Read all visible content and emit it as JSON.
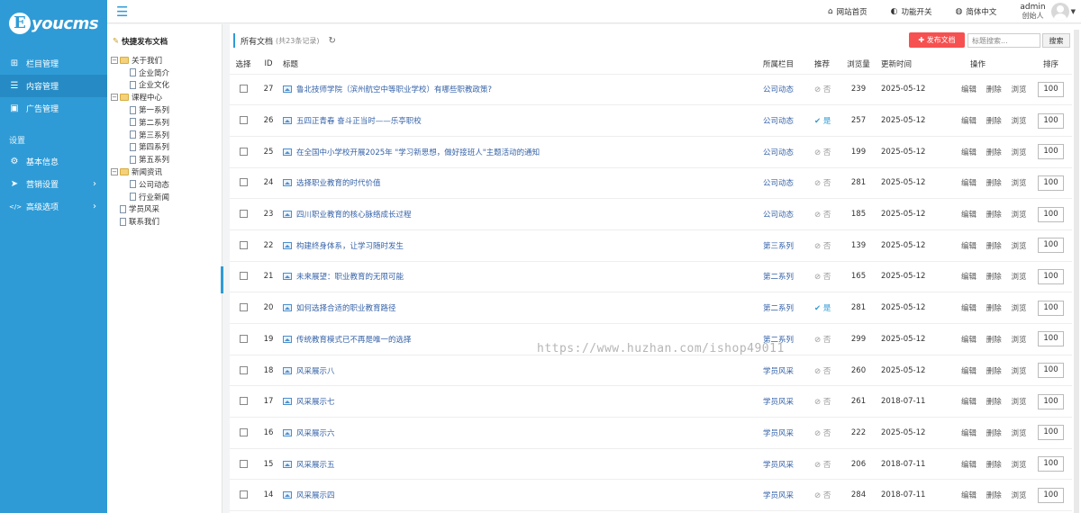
{
  "brand": {
    "badge": "E",
    "text": "youcms"
  },
  "sidebar": {
    "items": [
      {
        "label": "栏目管理",
        "icon": "sitemap-icon",
        "glyph": "⊞",
        "active": false
      },
      {
        "label": "内容管理",
        "icon": "list-icon",
        "glyph": "☰",
        "active": true
      },
      {
        "label": "广告管理",
        "icon": "image-icon",
        "glyph": "▣",
        "active": false
      }
    ],
    "settings_heading": "设置",
    "settings": [
      {
        "label": "基本信息",
        "icon": "gear-icon",
        "glyph": "⚙",
        "arrow": false
      },
      {
        "label": "营销设置",
        "icon": "send-icon",
        "glyph": "➤",
        "arrow": true
      },
      {
        "label": "高级选项",
        "icon": "code-icon",
        "glyph": "</>",
        "arrow": true
      }
    ]
  },
  "topbar": {
    "links": [
      {
        "label": "网站首页",
        "icon": "home-icon",
        "glyph": "⌂"
      },
      {
        "label": "功能开关",
        "icon": "toggle-icon",
        "glyph": "◐"
      },
      {
        "label": "简体中文",
        "icon": "globe-icon",
        "glyph": "◍"
      }
    ],
    "user_name": "admin",
    "user_role": "创始人"
  },
  "tree": {
    "heading": "快捷发布文档",
    "nodes": [
      {
        "label": "关于我们",
        "type": "folder"
      },
      {
        "label": "企业简介",
        "type": "child"
      },
      {
        "label": "企业文化",
        "type": "child"
      },
      {
        "label": "课程中心",
        "type": "folder"
      },
      {
        "label": "第一系列",
        "type": "child"
      },
      {
        "label": "第二系列",
        "type": "child"
      },
      {
        "label": "第三系列",
        "type": "child"
      },
      {
        "label": "第四系列",
        "type": "child"
      },
      {
        "label": "第五系列",
        "type": "child"
      },
      {
        "label": "新闻资讯",
        "type": "folder"
      },
      {
        "label": "公司动态",
        "type": "child"
      },
      {
        "label": "行业新闻",
        "type": "child"
      },
      {
        "label": "学员风采",
        "type": "leaf"
      },
      {
        "label": "联系我们",
        "type": "leaf"
      }
    ]
  },
  "main": {
    "title": "所有文档",
    "count": "(共23条记录)",
    "add_button": "✚ 发布文档",
    "search_placeholder": "标题搜索...",
    "search_button": "搜索",
    "columns": [
      "选择",
      "ID",
      "标题",
      "所属栏目",
      "推荐",
      "浏览量",
      "更新时间",
      "操作",
      "排序"
    ],
    "ops": [
      "编辑",
      "删除",
      "浏览"
    ],
    "rows": [
      {
        "id": "27",
        "title": "鲁北技师学院（滨州航空中等职业学校）有哪些职教政策?",
        "cat": "公司动态",
        "rec": "否",
        "views": "239",
        "date": "2025-05-12",
        "sort": "100"
      },
      {
        "id": "26",
        "title": "五四正青春 奋斗正当时——乐亭职校",
        "cat": "公司动态",
        "rec": "是",
        "views": "257",
        "date": "2025-05-12",
        "sort": "100"
      },
      {
        "id": "25",
        "title": "在全国中小学校开展2025年 \"学习新思想，做好接班人\"主题活动的通知",
        "cat": "公司动态",
        "rec": "否",
        "views": "199",
        "date": "2025-05-12",
        "sort": "100"
      },
      {
        "id": "24",
        "title": "选择职业教育的时代价值",
        "cat": "公司动态",
        "rec": "否",
        "views": "281",
        "date": "2025-05-12",
        "sort": "100"
      },
      {
        "id": "23",
        "title": "四川职业教育的核心脉络成长过程",
        "cat": "公司动态",
        "rec": "否",
        "views": "185",
        "date": "2025-05-12",
        "sort": "100"
      },
      {
        "id": "22",
        "title": "构建终身体系，让学习随时发生",
        "cat": "第三系列",
        "rec": "否",
        "views": "139",
        "date": "2025-05-12",
        "sort": "100"
      },
      {
        "id": "21",
        "title": "未来展望：职业教育的无限可能",
        "cat": "第二系列",
        "rec": "否",
        "views": "165",
        "date": "2025-05-12",
        "sort": "100"
      },
      {
        "id": "20",
        "title": "如何选择合适的职业教育路径",
        "cat": "第二系列",
        "rec": "是",
        "views": "281",
        "date": "2025-05-12",
        "sort": "100"
      },
      {
        "id": "19",
        "title": "传统教育模式已不再是唯一的选择",
        "cat": "第二系列",
        "rec": "否",
        "views": "299",
        "date": "2025-05-12",
        "sort": "100"
      },
      {
        "id": "18",
        "title": "风采展示八",
        "cat": "学员风采",
        "rec": "否",
        "views": "260",
        "date": "2025-05-12",
        "sort": "100"
      },
      {
        "id": "17",
        "title": "风采展示七",
        "cat": "学员风采",
        "rec": "否",
        "views": "261",
        "date": "2018-07-11",
        "sort": "100"
      },
      {
        "id": "16",
        "title": "风采展示六",
        "cat": "学员风采",
        "rec": "否",
        "views": "222",
        "date": "2025-05-12",
        "sort": "100"
      },
      {
        "id": "15",
        "title": "风采展示五",
        "cat": "学员风采",
        "rec": "否",
        "views": "206",
        "date": "2018-07-11",
        "sort": "100"
      },
      {
        "id": "14",
        "title": "风采展示四",
        "cat": "学员风采",
        "rec": "否",
        "views": "284",
        "date": "2018-07-11",
        "sort": "100"
      }
    ]
  },
  "watermark": "https://www.huzhan.com/ishop49011"
}
